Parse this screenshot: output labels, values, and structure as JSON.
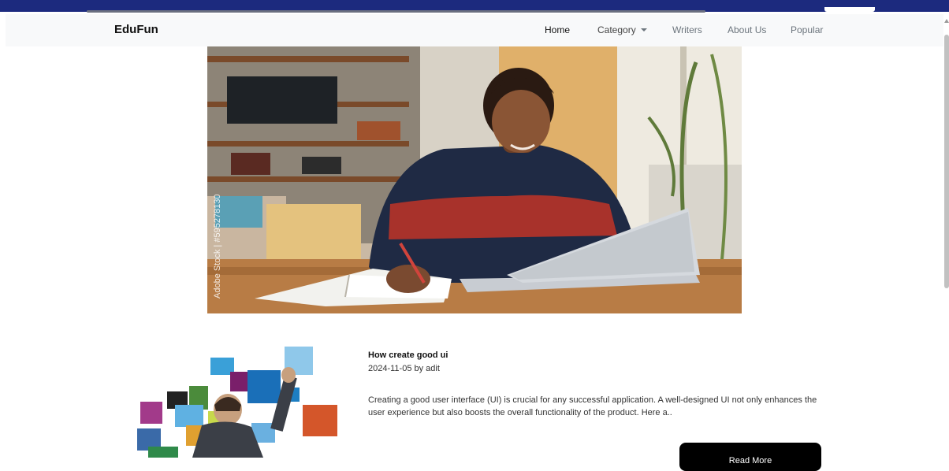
{
  "navbar": {
    "brand": "EduFun",
    "links": [
      {
        "label": "Home",
        "active": true
      },
      {
        "label": "Category",
        "dropdown": true
      },
      {
        "label": "Writers"
      },
      {
        "label": "About Us"
      },
      {
        "label": "Popular"
      }
    ]
  },
  "hero": {
    "image_subject": "student writing in notebook at laptop",
    "watermark": "Adobe Stock | #595278130"
  },
  "post": {
    "title": "How create good ui",
    "meta": "2024-11-05 by adit",
    "excerpt": "Creating a good user interface (UI) is crucial for any successful application. A well-designed UI not only enhances the user experience but also boosts the overall functionality of the product. Here a..",
    "read_more_label": "Read More",
    "thumbnail_subject": "man touching floating image tiles"
  },
  "colors": {
    "topbar": "#1c2a7e",
    "navbar_bg": "#f8f9fa",
    "button_bg": "#000000"
  }
}
